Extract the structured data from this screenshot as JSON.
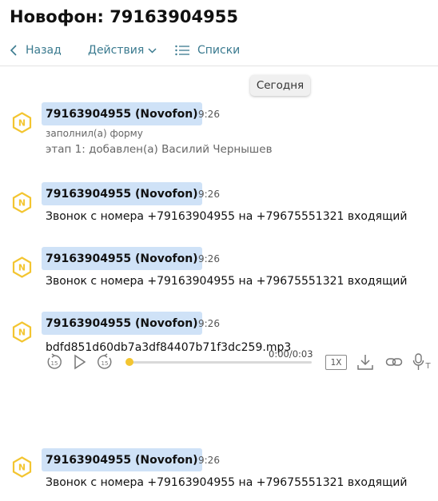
{
  "window": {
    "title": "Новофон: 79163904955"
  },
  "toolbar": {
    "back_label": "Назад",
    "actions_label": "Действия",
    "lists_label": "Списки"
  },
  "date_separator": "Сегодня",
  "messages": [
    {
      "sender": "79163904955 (Novofon)",
      "time": "9:26",
      "meta": "заполнил(а) форму",
      "text": "этап 1: добавлен(а) Василий Чернышев"
    },
    {
      "sender": "79163904955 (Novofon)",
      "time": "9:26",
      "text": "Звонок с номера +79163904955 на +79675551321 входящий"
    },
    {
      "sender": "79163904955 (Novofon)",
      "time": "9:26",
      "text": "Звонок с номера +79163904955 на +79675551321 входящий"
    },
    {
      "sender": "79163904955 (Novofon)",
      "time": "9:26",
      "text": "bdfd851d60db7a3df84407b71f3dc259.mp3",
      "player": {
        "duration": "0:00/0:03",
        "speed": "1X",
        "progress": 0
      }
    },
    {
      "sender": "79163904955 (Novofon)",
      "time": "9:26",
      "text": "Звонок с номера +79163904955 на +79675551321 входящий"
    }
  ],
  "icons": {
    "avatar": "novofon-logo-icon",
    "accent": "#f3c531",
    "link_color": "#3a7a8f",
    "sender_bg": "#cfe2f7"
  }
}
